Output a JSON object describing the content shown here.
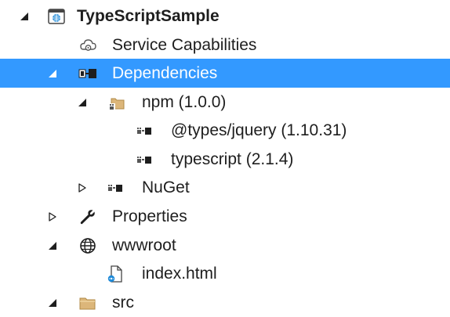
{
  "solution_explorer": {
    "project": {
      "label": "TypeScriptSample",
      "expanded": true,
      "icon": "web-project-icon"
    },
    "items": [
      {
        "label": "Service Capabilities",
        "icon": "cloud-gear-icon"
      },
      {
        "label": "Dependencies",
        "icon": "dependencies-icon",
        "expanded": true,
        "selected": true
      },
      {
        "label": "npm (1.0.0)",
        "icon": "npm-folder-icon",
        "expanded": true
      },
      {
        "label": "@types/jquery (1.10.31)",
        "icon": "package-icon"
      },
      {
        "label": "typescript (2.1.4)",
        "icon": "package-icon"
      },
      {
        "label": "NuGet",
        "icon": "package-icon",
        "expanded": false
      },
      {
        "label": "Properties",
        "icon": "wrench-icon",
        "expanded": false
      },
      {
        "label": "wwwroot",
        "icon": "globe-icon",
        "expanded": true
      },
      {
        "label": "index.html",
        "icon": "html-file-icon"
      },
      {
        "label": "src",
        "icon": "folder-icon",
        "expanded": true
      }
    ],
    "selection_color": "#3399ff"
  }
}
